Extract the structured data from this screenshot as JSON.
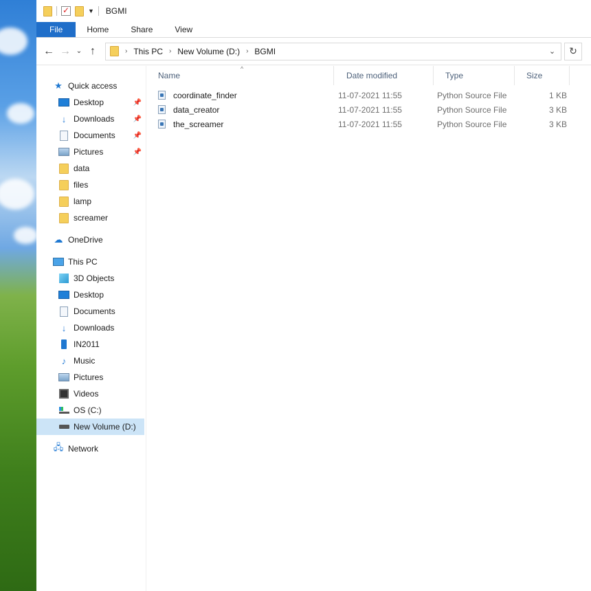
{
  "window": {
    "title": "BGMI"
  },
  "ribbon": {
    "tabs": [
      "File",
      "Home",
      "Share",
      "View"
    ]
  },
  "address": {
    "crumbs": [
      "This PC",
      "New Volume (D:)",
      "BGMI"
    ]
  },
  "sidebar": {
    "quick_access": "Quick access",
    "quick_items": [
      "Desktop",
      "Downloads",
      "Documents",
      "Pictures",
      "data",
      "files",
      "lamp",
      "screamer"
    ],
    "onedrive": "OneDrive",
    "this_pc": "This PC",
    "pc_items": [
      "3D Objects",
      "Desktop",
      "Documents",
      "Downloads",
      "IN2011",
      "Music",
      "Pictures",
      "Videos",
      "OS (C:)",
      "New Volume (D:)"
    ],
    "network": "Network"
  },
  "columns": {
    "name": "Name",
    "date": "Date modified",
    "type": "Type",
    "size": "Size"
  },
  "files": [
    {
      "name": "coordinate_finder",
      "date": "11-07-2021 11:55",
      "type": "Python Source File",
      "size": "1 KB"
    },
    {
      "name": "data_creator",
      "date": "11-07-2021 11:55",
      "type": "Python Source File",
      "size": "3 KB"
    },
    {
      "name": "the_screamer",
      "date": "11-07-2021 11:55",
      "type": "Python Source File",
      "size": "3 KB"
    }
  ]
}
